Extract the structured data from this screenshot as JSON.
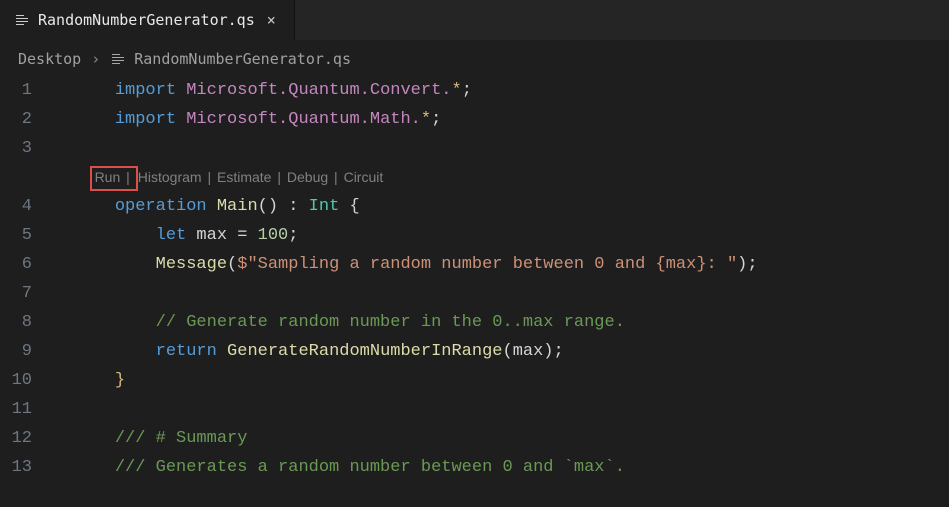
{
  "tab": {
    "filename": "RandomNumberGenerator.qs"
  },
  "breadcrumbs": {
    "folder": "Desktop",
    "file": "RandomNumberGenerator.qs"
  },
  "codelens": {
    "run": "Run",
    "histogram": "Histogram",
    "estimate": "Estimate",
    "debug": "Debug",
    "circuit": "Circuit"
  },
  "ln": {
    "l1": "1",
    "l2": "2",
    "l3": "3",
    "l4": "4",
    "l5": "5",
    "l6": "6",
    "l7": "7",
    "l8": "8",
    "l9": "9",
    "l10": "10",
    "l11": "11",
    "l12": "12",
    "l13": "13"
  },
  "code": {
    "kw_import": "import",
    "ns_convert": "Microsoft.Quantum.Convert.",
    "ns_math": "Microsoft.Quantum.Math.",
    "star": "*",
    "semi": ";",
    "kw_operation": "operation",
    "main": "Main",
    "parens": "()",
    "colon": " : ",
    "int_type": "Int",
    "obrace": " {",
    "kw_let": "let",
    "maxdecl": " max = ",
    "hundred": "100",
    "message": "Message",
    "msg_open": "(",
    "msg_dollar_quote": "$\"",
    "msg_text1": "Sampling a random number between 0 and ",
    "msg_interp": "{max}",
    "msg_text2": ": ",
    "msg_close_quote": "\"",
    "msg_close_paren": ")",
    "cmt_gen": "// Generate random number in the 0..max range.",
    "kw_return": "return",
    "gen_fn": "GenerateRandomNumberInRange",
    "gen_args": "(max)",
    "cbrace": "}",
    "doc_summary": "/// # Summary",
    "doc_gen": "/// Generates a random number between 0 and `max`."
  }
}
